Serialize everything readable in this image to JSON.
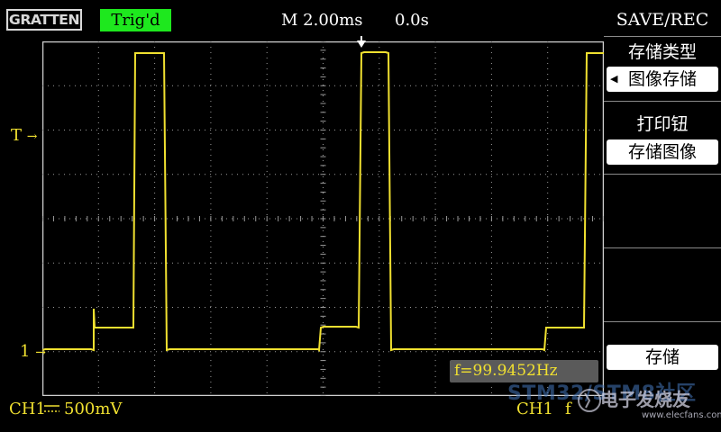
{
  "header": {
    "logo_text": "GRATTEN",
    "trigger_status": "Trig'd",
    "trigger_status_color": "#1ee81e",
    "timebase": "M 2.00ms",
    "time_position": "0.0s"
  },
  "waveform": {
    "color": "#f0e030",
    "trigger_level_label": "T",
    "channel_ground_label": "1",
    "signal": "square wave with step-up before each pulse",
    "frequency_hz": 99.9452
  },
  "status": {
    "ch1_label": "CH1",
    "ch1_scale": "500mV",
    "ch1_right_label": "CH1",
    "frequency_symbol": "f",
    "frequency_readout": "f=99.9452Hz"
  },
  "menu": {
    "title": "SAVE/REC",
    "save_type_label": "存储类型",
    "save_type_value": "图像存储",
    "print_button_label": "打印钮",
    "print_button_value": "存储图像",
    "save_action_label": "存储"
  },
  "watermark": {
    "line1": "STM32/STM8社区",
    "line2": "电子发烧友",
    "line3": "www.elecfans.com"
  }
}
